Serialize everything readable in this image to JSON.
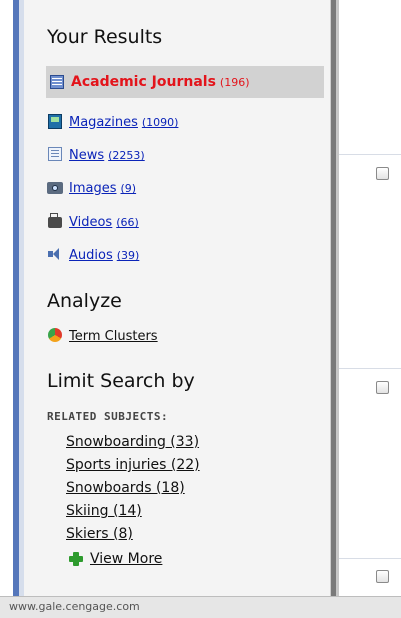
{
  "sidebar": {
    "results_heading": "Your Results",
    "results": [
      {
        "label": "Academic Journals",
        "count": "(196)",
        "icon": "journal-icon",
        "selected": true
      },
      {
        "label": "Magazines",
        "count": "(1090)",
        "icon": "magazine-icon"
      },
      {
        "label": "News",
        "count": "(2253)",
        "icon": "news-icon"
      },
      {
        "label": "Images",
        "count": "(9)",
        "icon": "camera-icon"
      },
      {
        "label": "Videos",
        "count": "(66)",
        "icon": "video-camera-icon"
      },
      {
        "label": "Audios",
        "count": "(39)",
        "icon": "speaker-icon"
      }
    ],
    "analyze_heading": "Analyze",
    "term_clusters_label": "Term Clusters",
    "limit_heading": "Limit Search by",
    "related_subjects_label": "RELATED SUBJECTS:",
    "subjects": [
      "Snowboarding (33)",
      "Sports injuries (22)",
      "Snowboards (18)",
      "Skiing (14)",
      "Skiers (8)"
    ],
    "view_more_label": "View More"
  },
  "status_bar": {
    "text": "www.gale.cengage.com"
  },
  "colors": {
    "link": "#0b24b8",
    "selected": "#e3141b",
    "frame_blue": "#5577bb",
    "add_green": "#2e9b2e"
  }
}
